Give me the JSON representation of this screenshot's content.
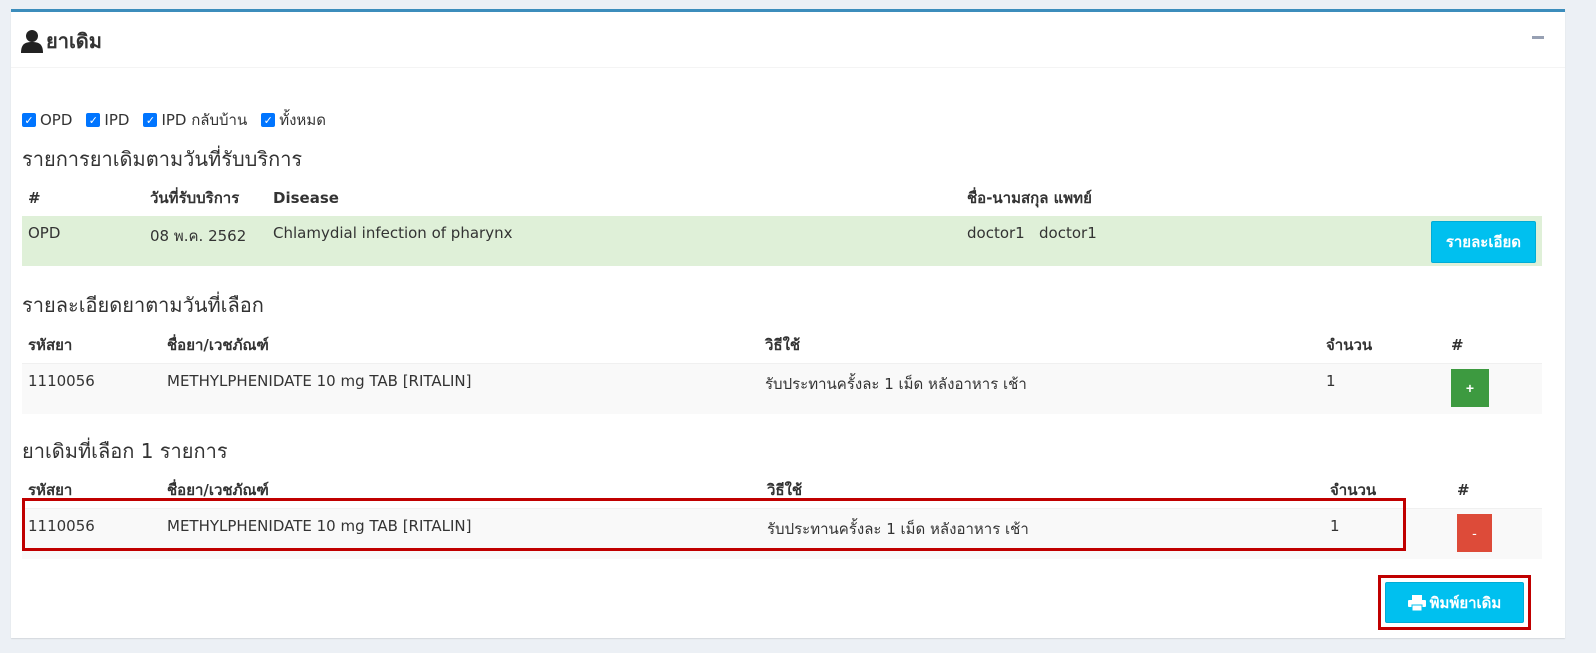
{
  "header": {
    "title": "ยาเดิม"
  },
  "filters": [
    {
      "label": "OPD",
      "checked": true
    },
    {
      "label": "IPD",
      "checked": true
    },
    {
      "label": "IPD กลับบ้าน",
      "checked": true
    },
    {
      "label": "ทั้งหมด",
      "checked": true
    }
  ],
  "visits": {
    "title": "รายการยาเดิมตามวันที่รับบริการ",
    "headers": [
      "#",
      "วันที่รับบริการ",
      "Disease",
      "ชื่อ-นามสกุล แพทย์",
      ""
    ],
    "rows": [
      {
        "type": "OPD",
        "date": "08 พ.ค. 2562",
        "disease": "Chlamydial infection of pharynx",
        "doctor": "doctor1   doctor1",
        "action": "รายละเอียด"
      }
    ]
  },
  "details": {
    "title": "รายละเอียดยาตามวันที่เลือก",
    "headers": [
      "รหัสยา",
      "ชื่อยา/เวชภัณฑ์",
      "วิธีใช้",
      "จำนวน",
      "#"
    ],
    "rows": [
      {
        "code": "1110056",
        "name": "METHYLPHENIDATE 10 mg TAB [RITALIN]",
        "usage": "รับประทานครั้งละ 1 เม็ด หลังอาหาร เช้า",
        "qty": "1",
        "action": "+"
      }
    ]
  },
  "selected": {
    "title": "ยาเดิมที่เลือก 1 รายการ",
    "headers": [
      "รหัสยา",
      "ชื่อยา/เวชภัณฑ์",
      "วิธีใช้",
      "จำนวน",
      "#"
    ],
    "rows": [
      {
        "code": "1110056",
        "name": "METHYLPHENIDATE 10 mg TAB [RITALIN]",
        "usage": "รับประทานครั้งละ 1 เม็ด หลังอาหาร เช้า",
        "qty": "1",
        "action": "-"
      }
    ]
  },
  "print_button": {
    "label": "พิมพ์ยาเดิม",
    "icon": "printer-icon"
  },
  "colors": {
    "primary": "#3c8dbc",
    "info": "#00c0ef",
    "success": "#3d9a40",
    "danger": "#dd4b39",
    "highlight": "#c00000"
  }
}
